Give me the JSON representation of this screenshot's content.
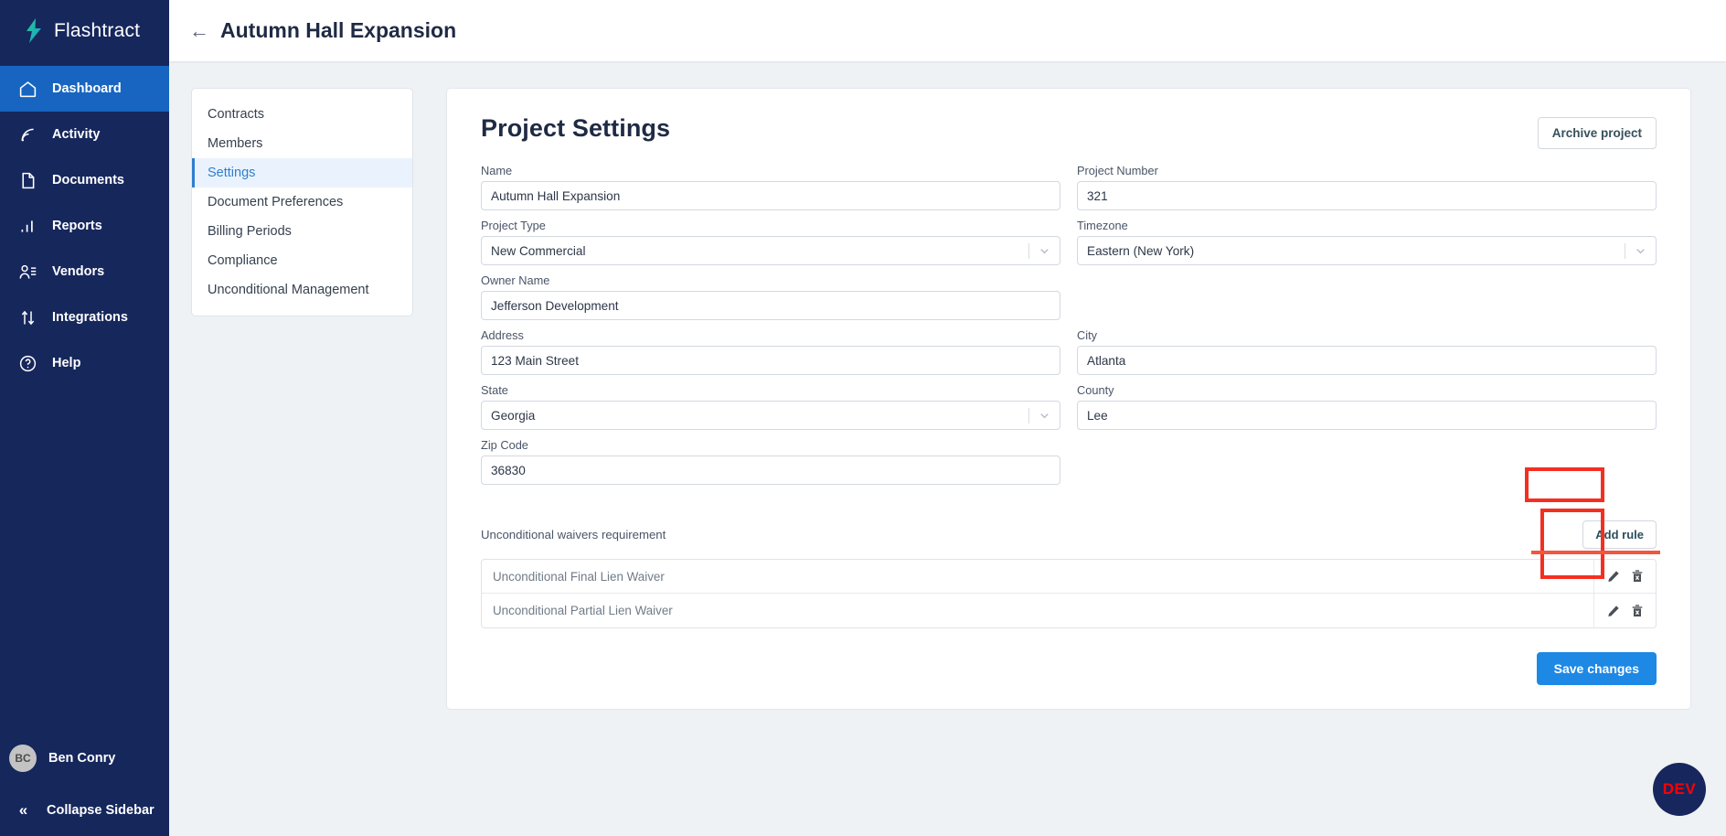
{
  "brand": {
    "name": "Flashtract",
    "logo_icon": "lightning-bolt-icon"
  },
  "sidebar": {
    "items": [
      {
        "label": "Dashboard",
        "icon": "home-icon",
        "active": true
      },
      {
        "label": "Activity",
        "icon": "activity-feed-icon",
        "active": false
      },
      {
        "label": "Documents",
        "icon": "document-icon",
        "active": false
      },
      {
        "label": "Reports",
        "icon": "bar-chart-icon",
        "active": false
      },
      {
        "label": "Vendors",
        "icon": "user-list-icon",
        "active": false
      },
      {
        "label": "Integrations",
        "icon": "arrows-updown-icon",
        "active": false
      },
      {
        "label": "Help",
        "icon": "question-circle-icon",
        "active": false
      }
    ],
    "user": {
      "initials": "BC",
      "name": "Ben Conry"
    },
    "collapse_label": "Collapse Sidebar",
    "collapse_icon": "chevron-double-left-icon"
  },
  "header": {
    "back_icon": "arrow-left-icon",
    "title": "Autumn Hall Expansion"
  },
  "subnav": {
    "items": [
      {
        "label": "Contracts",
        "active": false
      },
      {
        "label": "Members",
        "active": false
      },
      {
        "label": "Settings",
        "active": true
      },
      {
        "label": "Document Preferences",
        "active": false
      },
      {
        "label": "Billing Periods",
        "active": false
      },
      {
        "label": "Compliance",
        "active": false
      },
      {
        "label": "Unconditional Management",
        "active": false
      }
    ]
  },
  "settings": {
    "title": "Project Settings",
    "archive_label": "Archive project",
    "fields": {
      "name": {
        "label": "Name",
        "value": "Autumn Hall Expansion"
      },
      "project_number": {
        "label": "Project Number",
        "value": "321"
      },
      "project_type": {
        "label": "Project Type",
        "value": "New Commercial"
      },
      "timezone": {
        "label": "Timezone",
        "value": "Eastern (New York)"
      },
      "owner_name": {
        "label": "Owner Name",
        "value": "Jefferson Development"
      },
      "address": {
        "label": "Address",
        "value": "123 Main Street"
      },
      "city": {
        "label": "City",
        "value": "Atlanta"
      },
      "state": {
        "label": "State",
        "value": "Georgia"
      },
      "county": {
        "label": "County",
        "value": "Lee"
      },
      "zip_code": {
        "label": "Zip Code",
        "value": "36830"
      }
    },
    "waivers": {
      "label": "Unconditional waivers requirement",
      "add_rule_label": "Add rule",
      "rows": [
        {
          "text": "Unconditional Final Lien Waiver",
          "edit_icon": "pencil-icon",
          "delete_icon": "trash-x-icon"
        },
        {
          "text": "Unconditional Partial Lien Waiver",
          "edit_icon": "pencil-icon",
          "delete_icon": "trash-x-icon"
        }
      ]
    },
    "save_label": "Save changes"
  },
  "dev_badge": {
    "label": "DEV"
  },
  "colors": {
    "sidebar_bg": "#16275c",
    "sidebar_active": "#1765c0",
    "accent_blue": "#1e88e5",
    "subnav_active_text": "#2f7ed0",
    "annotation_red": "#f42f22",
    "page_bg": "#eef2f5"
  }
}
